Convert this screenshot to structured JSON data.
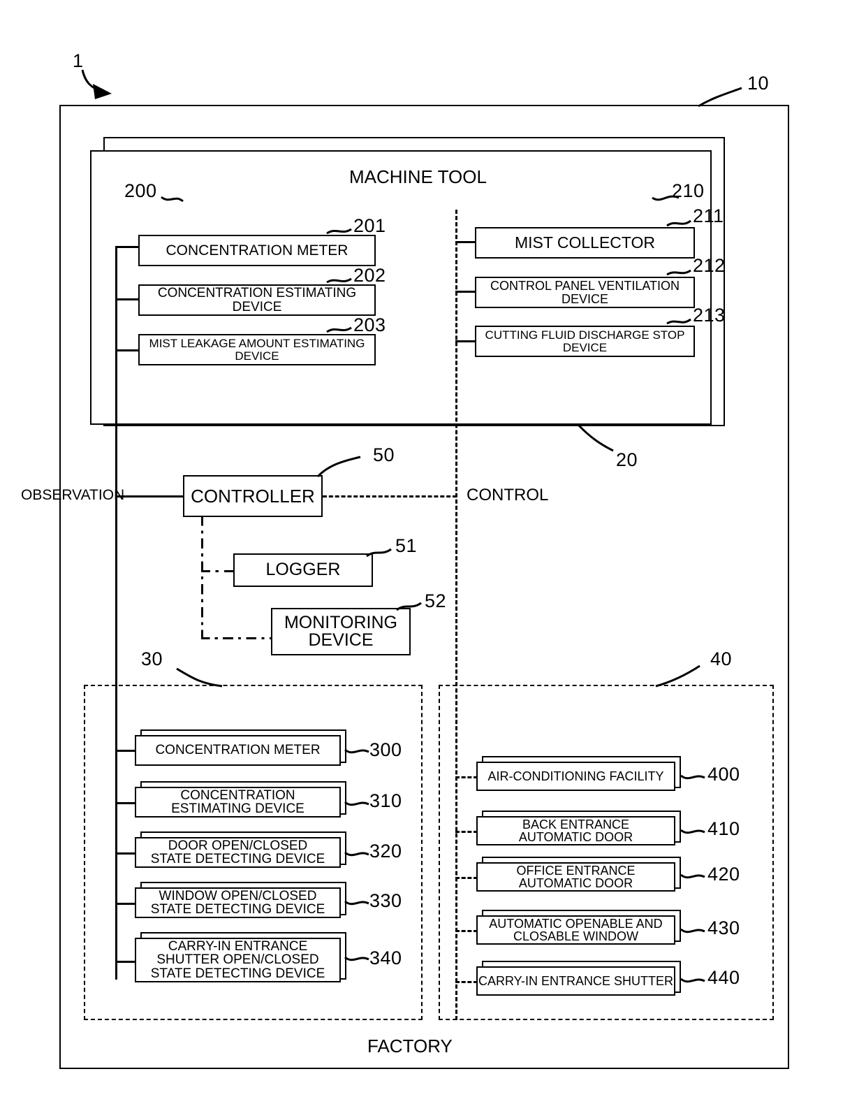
{
  "figure": {
    "overall_ref": "1",
    "outer_system_ref": "10",
    "machine_tool_ref": "20",
    "machine_tool_title": "MACHINE TOOL",
    "factory_title": "FACTORY",
    "observation_label": "OBSERVATION",
    "control_label": "CONTROL"
  },
  "machine_tool": {
    "observation_group": {
      "ref": "200",
      "items": [
        {
          "ref": "201",
          "label": "CONCENTRATION METER"
        },
        {
          "ref": "202",
          "label": "CONCENTRATION ESTIMATING DEVICE"
        },
        {
          "ref": "203",
          "label": "MIST LEAKAGE AMOUNT ESTIMATING DEVICE"
        }
      ]
    },
    "control_group": {
      "ref": "210",
      "items": [
        {
          "ref": "211",
          "label": "MIST COLLECTOR"
        },
        {
          "ref": "212",
          "label": "CONTROL PANEL VENTILATION DEVICE"
        },
        {
          "ref": "213",
          "label": "CUTTING FLUID DISCHARGE STOP DEVICE"
        }
      ]
    }
  },
  "middle": {
    "controller": {
      "ref": "50",
      "label": "CONTROLLER"
    },
    "logger": {
      "ref": "51",
      "label": "LOGGER"
    },
    "monitoring_device": {
      "ref": "52",
      "label_line1": "MONITORING",
      "label_line2": "DEVICE"
    }
  },
  "factory": {
    "observation_group": {
      "ref": "30",
      "items": [
        {
          "ref": "300",
          "lines": [
            "CONCENTRATION METER"
          ]
        },
        {
          "ref": "310",
          "lines": [
            "CONCENTRATION",
            "ESTIMATING DEVICE"
          ]
        },
        {
          "ref": "320",
          "lines": [
            "DOOR OPEN/CLOSED",
            "STATE DETECTING DEVICE"
          ]
        },
        {
          "ref": "330",
          "lines": [
            "WINDOW OPEN/CLOSED",
            "STATE DETECTING DEVICE"
          ]
        },
        {
          "ref": "340",
          "lines": [
            "CARRY-IN ENTRANCE",
            "SHUTTER OPEN/CLOSED",
            "STATE DETECTING DEVICE"
          ]
        }
      ]
    },
    "control_group": {
      "ref": "40",
      "items": [
        {
          "ref": "400",
          "lines": [
            "AIR-CONDITIONING FACILITY"
          ]
        },
        {
          "ref": "410",
          "lines": [
            "BACK ENTRANCE",
            "AUTOMATIC DOOR"
          ]
        },
        {
          "ref": "420",
          "lines": [
            "OFFICE ENTRANCE",
            "AUTOMATIC DOOR"
          ]
        },
        {
          "ref": "430",
          "lines": [
            "AUTOMATIC OPENABLE AND",
            "CLOSABLE WINDOW"
          ]
        },
        {
          "ref": "440",
          "lines": [
            "CARRY-IN ENTRANCE SHUTTER"
          ]
        }
      ]
    }
  },
  "colors": {
    "line": "#000000",
    "background": "#ffffff"
  }
}
